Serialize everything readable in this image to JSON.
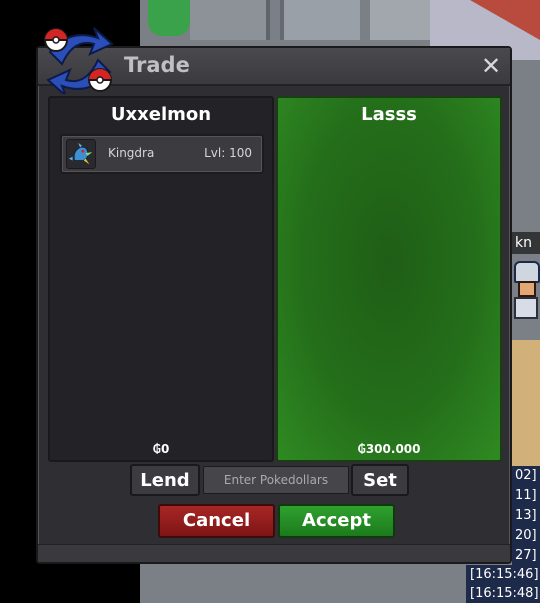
{
  "window": {
    "title": "Trade",
    "close_label": "✕"
  },
  "left_panel": {
    "player_name": "Uxxelmon",
    "money": "₲0",
    "items": [
      {
        "name": "Kingdra",
        "level": "Lvl: 100",
        "icon": "kingdra-sprite-icon"
      }
    ]
  },
  "right_panel": {
    "player_name": "Lasss",
    "money": "₲300.000"
  },
  "controls": {
    "lend_label": "Lend",
    "money_placeholder": "Enter Pokedollars",
    "set_label": "Set",
    "cancel_label": "Cancel",
    "accept_label": "Accept"
  },
  "world": {
    "npc_tag": "kn"
  },
  "chat": {
    "lines": [
      "02]",
      "11]",
      "13]",
      "20]",
      "27]"
    ],
    "timestamps": [
      "[16:15:46]",
      "[16:15:48]"
    ]
  },
  "colors": {
    "accept": "#1c7a1c",
    "cancel": "#7e1515",
    "partner_panel": "#246e1a",
    "window_bg": "#2f2f33"
  }
}
